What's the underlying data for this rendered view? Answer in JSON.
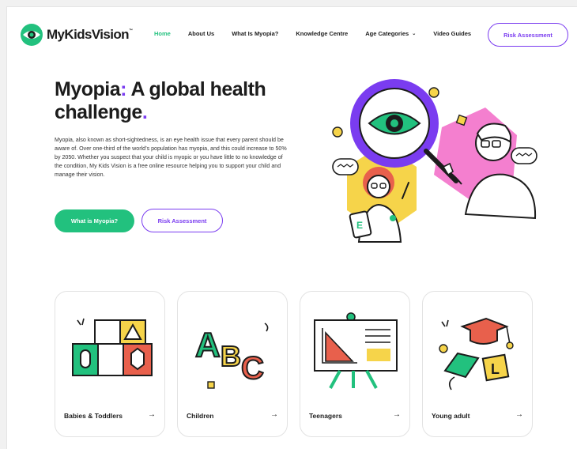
{
  "brand": {
    "name": "MyKidsVision",
    "trademark": "™"
  },
  "nav": {
    "items": [
      {
        "label": "Home",
        "active": true
      },
      {
        "label": "About Us"
      },
      {
        "label": "What Is Myopia?"
      },
      {
        "label": "Knowledge Centre"
      },
      {
        "label": "Age Categories",
        "dropdown": true
      },
      {
        "label": "Video Guides"
      }
    ],
    "chevron": "⌄",
    "cta_label": "Risk Assessment"
  },
  "hero": {
    "title_part1": "Myopia",
    "title_colon": ":",
    "title_part2": " A global health challenge",
    "title_dot": ".",
    "body": "Myopia, also known as short-sightedness, is an eye health issue that every parent should be aware of. Over one-third of the world’s population has myopia, and this could increase to 50% by 2050. Whether you suspect that your child is myopic or you have little to no knowledge of the condition, My Kids Vision is a free online resource helping you to support your child and manage their vision.",
    "primary_button": "What is Myopia?",
    "secondary_button": "Risk Assessment"
  },
  "cards": [
    {
      "label": "Babies & Toddlers",
      "arrow": "→",
      "icon": "blocks-icon"
    },
    {
      "label": "Children",
      "arrow": "→",
      "icon": "abc-letters-icon"
    },
    {
      "label": "Teenagers",
      "arrow": "→",
      "icon": "whiteboard-icon"
    },
    {
      "label": "Young adult",
      "arrow": "→",
      "icon": "graduation-cap-icon"
    }
  ],
  "colors": {
    "brand_green": "#22c17e",
    "accent_purple": "#7a3cf0",
    "yellow": "#f6d44a",
    "pink": "#f47fcf",
    "red": "#e8604c"
  }
}
